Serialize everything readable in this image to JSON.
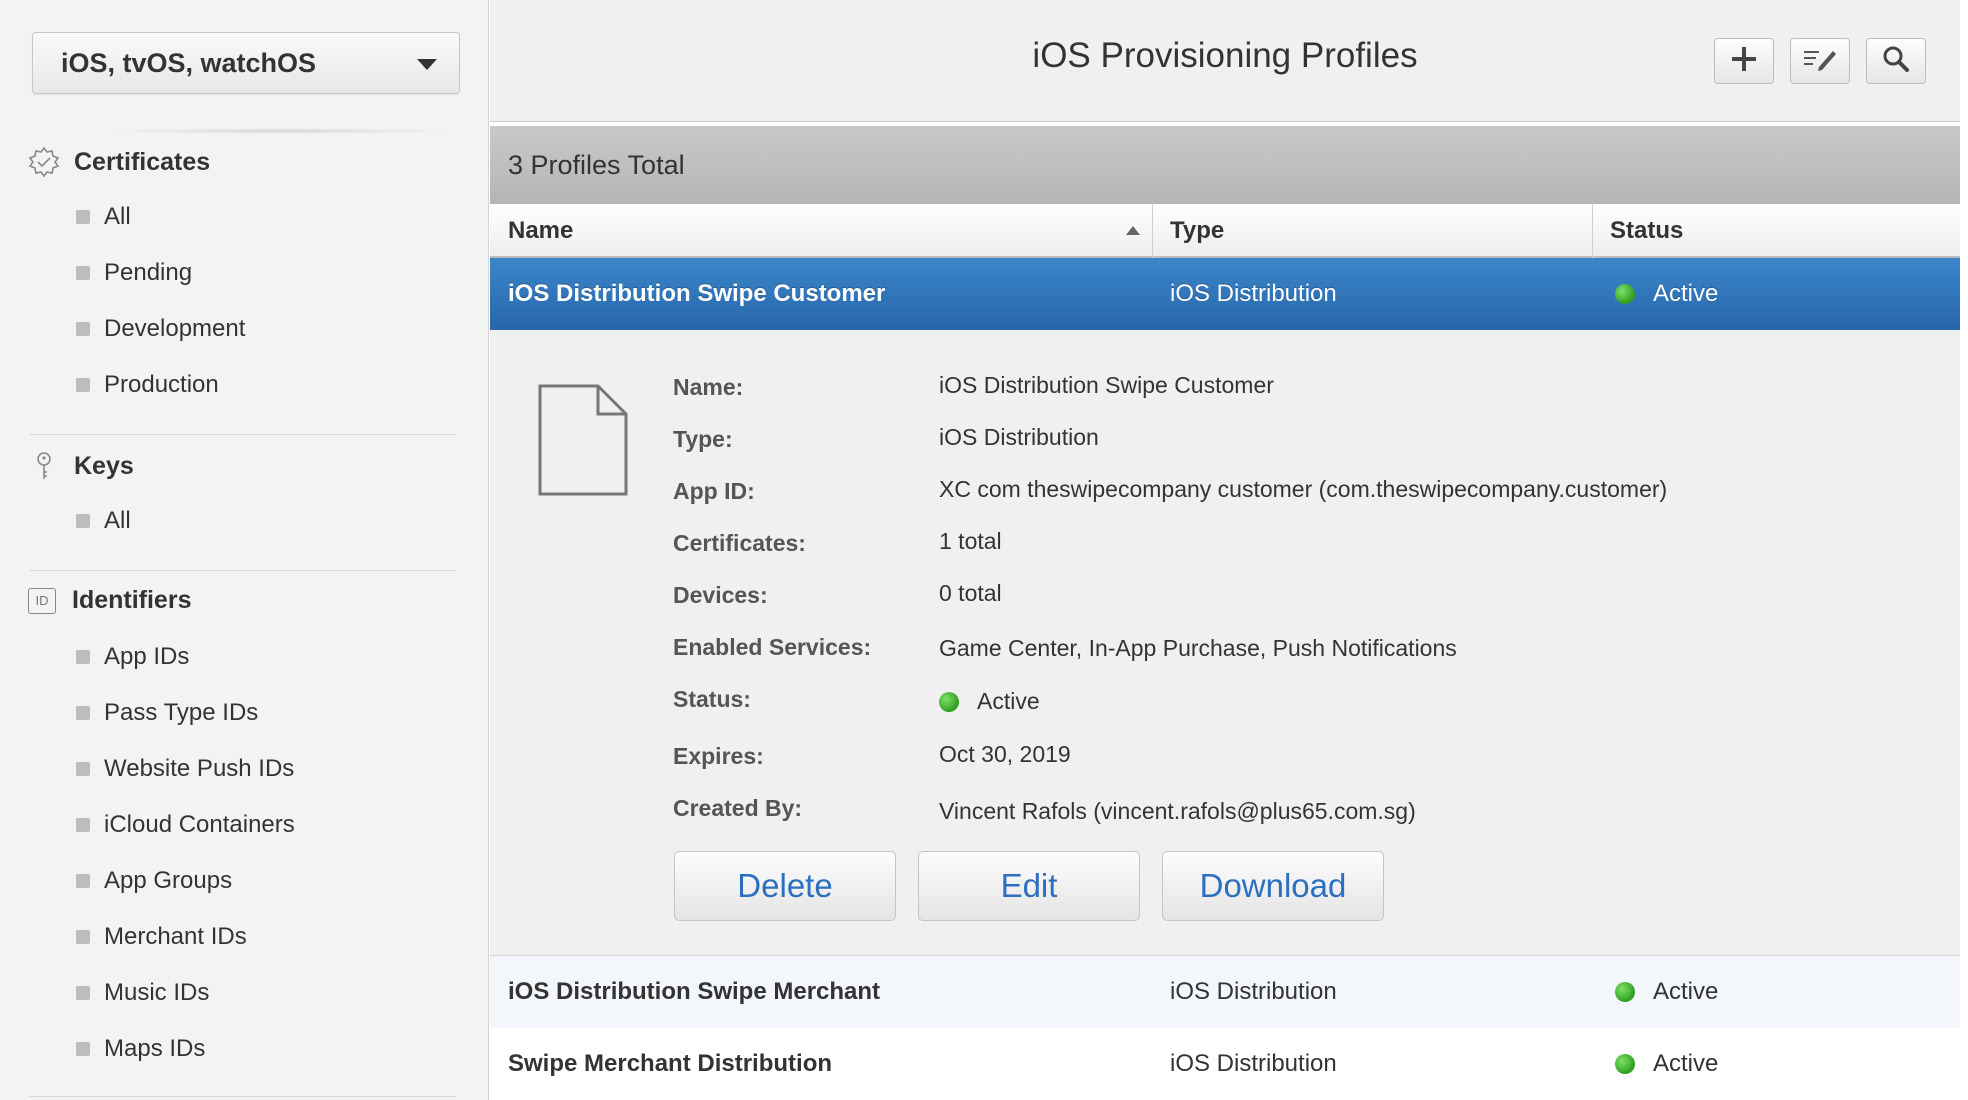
{
  "sidebar": {
    "platform": "iOS, tvOS, watchOS",
    "sections": {
      "certificates": {
        "title": "Certificates",
        "items": [
          "All",
          "Pending",
          "Development",
          "Production"
        ]
      },
      "keys": {
        "title": "Keys",
        "items": [
          "All"
        ]
      },
      "identifiers": {
        "title": "Identifiers",
        "badge": "ID",
        "items": [
          "App IDs",
          "Pass Type IDs",
          "Website Push IDs",
          "iCloud Containers",
          "App Groups",
          "Merchant IDs",
          "Music IDs",
          "Maps IDs"
        ]
      }
    }
  },
  "header": {
    "title": "iOS Provisioning Profiles"
  },
  "list": {
    "total": "3 Profiles Total",
    "columns": {
      "name": "Name",
      "type": "Type",
      "status": "Status"
    },
    "rows": [
      {
        "name": "iOS Distribution Swipe Customer",
        "type": "iOS Distribution",
        "status": "Active"
      },
      {
        "name": "iOS Distribution Swipe Merchant",
        "type": "iOS Distribution",
        "status": "Active"
      },
      {
        "name": "Swipe Merchant Distribution",
        "type": "iOS Distribution",
        "status": "Active"
      }
    ]
  },
  "detail": {
    "labels": {
      "name": "Name:",
      "type": "Type:",
      "app_id": "App ID:",
      "certificates": "Certificates:",
      "devices": "Devices:",
      "services": "Enabled Services:",
      "status": "Status:",
      "expires": "Expires:",
      "created_by": "Created By:"
    },
    "values": {
      "name": "iOS Distribution Swipe Customer",
      "type": "iOS Distribution",
      "app_id": "XC com theswipecompany customer (com.theswipecompany.customer)",
      "certificates": "1 total",
      "devices": "0 total",
      "services": "Game Center, In-App Purchase, Push Notifications",
      "status": "Active",
      "expires": "Oct 30, 2019",
      "created_by": "Vincent Rafols (vincent.rafols@plus65.com.sg)"
    },
    "buttons": {
      "delete": "Delete",
      "edit": "Edit",
      "download": "Download"
    }
  },
  "colors": {
    "selected_row": "#2f74bb",
    "status_active": "#3cb02a",
    "action_text": "#2a6fc0"
  }
}
